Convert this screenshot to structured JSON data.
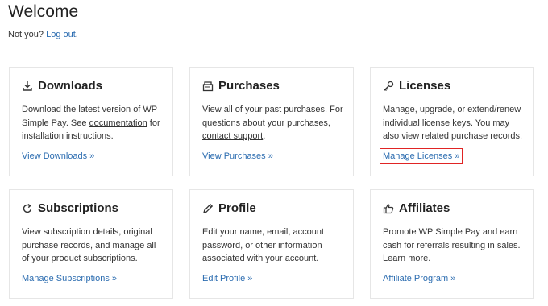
{
  "page": {
    "title": "Welcome",
    "not_you": "Not you?",
    "logout": "Log out",
    "logout_suffix": "."
  },
  "cards": [
    {
      "title": "Downloads",
      "icon": "download-icon",
      "desc_pre": "Download the latest version of WP Simple Pay. See ",
      "desc_link": "documentation",
      "desc_post": " for installation instructions.",
      "link": "View Downloads »"
    },
    {
      "title": "Purchases",
      "icon": "receipt-icon",
      "desc_pre": "View all of your past purchases. For questions about your purchases, ",
      "desc_link": "contact support",
      "desc_post": ".",
      "link": "View Purchases »"
    },
    {
      "title": "Licenses",
      "icon": "key-icon",
      "desc_pre": "Manage, upgrade, or extend/renew individual license keys. You may also view related purchase records.",
      "desc_link": "",
      "desc_post": "",
      "link": "Manage Licenses »",
      "highlighted": true
    },
    {
      "title": "Subscriptions",
      "icon": "refresh-icon",
      "desc_pre": "View subscription details, original purchase records, and manage all of your product subscriptions.",
      "desc_link": "",
      "desc_post": "",
      "link": "Manage Subscriptions »"
    },
    {
      "title": "Profile",
      "icon": "pencil-icon",
      "desc_pre": "Edit your name, email, account password, or other information associated with your account.",
      "desc_link": "",
      "desc_post": "",
      "link": "Edit Profile »"
    },
    {
      "title": "Affiliates",
      "icon": "thumbs-up-icon",
      "desc_pre": "Promote WP Simple Pay and earn cash for referrals resulting in sales. Learn more.",
      "desc_link": "",
      "desc_post": "",
      "link": "Affiliate Program »"
    }
  ],
  "colors": {
    "link": "#2b6cb0",
    "highlight": "#e02424",
    "border": "#e6e6e6"
  }
}
